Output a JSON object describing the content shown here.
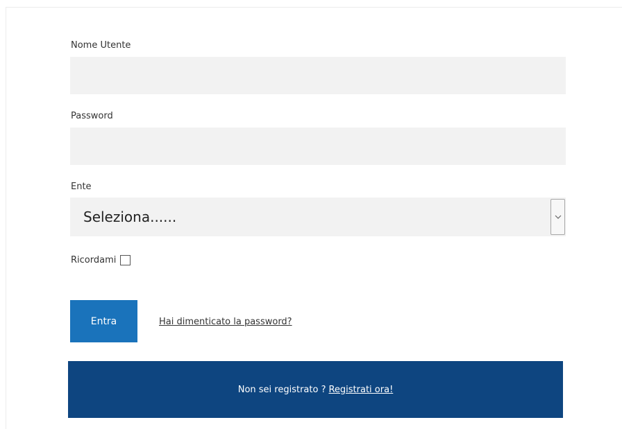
{
  "form": {
    "username": {
      "label": "Nome Utente",
      "value": ""
    },
    "password": {
      "label": "Password",
      "value": ""
    },
    "ente": {
      "label": "Ente",
      "selected": "Seleziona......"
    },
    "remember": {
      "label": "Ricordami",
      "checked": false
    },
    "login_button": "Entra",
    "forgot_link": "Hai dimenticato la password?"
  },
  "register": {
    "prompt": "Non sei registrato ?",
    "link": "Registrati ora!"
  },
  "colors": {
    "primary_button": "#1a73bb",
    "register_bar": "#0e4580",
    "input_background": "#f2f2f2"
  }
}
